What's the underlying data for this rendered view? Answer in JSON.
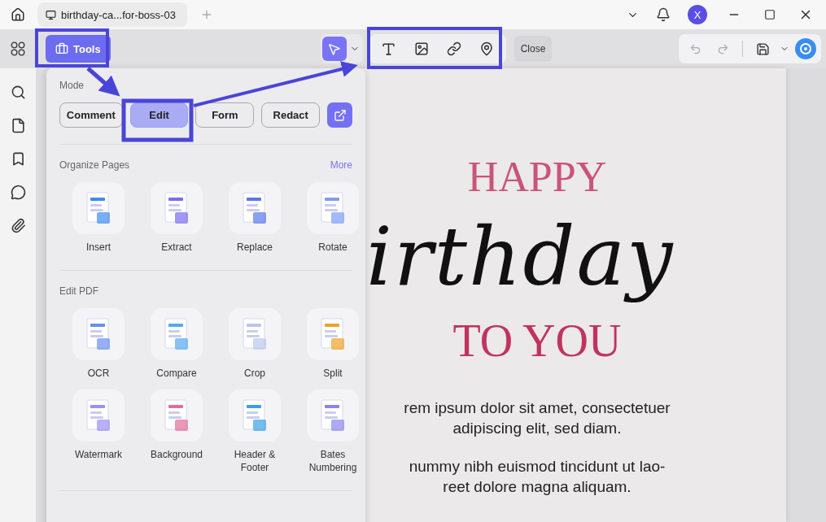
{
  "tab": {
    "title": "birthday-ca...for-boss-03"
  },
  "account": {
    "initial": "X"
  },
  "toolbar": {
    "tools_label": "Tools",
    "close_label": "Close"
  },
  "panel": {
    "mode_title": "Mode",
    "modes": [
      {
        "label": "Comment",
        "selected": false
      },
      {
        "label": "Edit",
        "selected": true
      },
      {
        "label": "Form",
        "selected": false
      },
      {
        "label": "Redact",
        "selected": false
      }
    ],
    "sections": [
      {
        "title": "Organize Pages",
        "more": "More",
        "items": [
          "Insert",
          "Extract",
          "Replace",
          "Rotate"
        ]
      },
      {
        "title": "Edit PDF",
        "items": [
          "OCR",
          "Compare",
          "Crop",
          "Split",
          "Watermark",
          "Background",
          "Header & Footer",
          "Bates Numbering"
        ]
      }
    ]
  },
  "document": {
    "title_top": "HAPPY",
    "script": "irthday",
    "title_bottom": "TO YOU",
    "paragraphs": [
      [
        "rem ipsum dolor sit amet, consectetuer",
        "adipiscing elit, sed diam."
      ],
      [
        "nummy nibh euismod tincidunt ut lao-",
        "reet dolore magna aliquam."
      ]
    ]
  }
}
